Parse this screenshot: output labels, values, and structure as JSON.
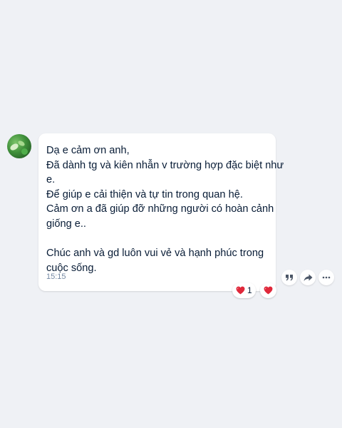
{
  "message": {
    "lines": [
      "Dạ e cảm ơn anh,",
      "Đã dành tg và kiên nhẫn v trường hợp đặc biệt như",
      "e.",
      "Để giúp e cải thiện và tự tin trong quan hệ.",
      "Cảm ơn a đã giúp đỡ những người có hoàn cảnh",
      "giống e..",
      "",
      "Chúc anh và gd luôn vui vẻ và hạnh phúc trong",
      "cuộc sống."
    ],
    "time": "15:15"
  },
  "reactions": {
    "count": "1",
    "icon": "heart-icon",
    "color": "#e0283a"
  },
  "actions": [
    {
      "name": "quote-icon"
    },
    {
      "name": "share-icon"
    },
    {
      "name": "more-icon"
    }
  ],
  "colors": {
    "background": "#eff1f5",
    "bubble": "#ffffff",
    "text": "#081c36",
    "time": "#7589a3"
  }
}
